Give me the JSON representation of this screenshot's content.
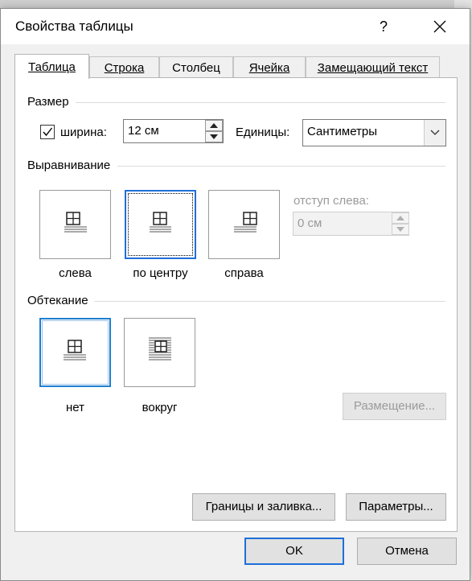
{
  "window": {
    "title": "Свойства таблицы",
    "help": "?",
    "close_icon": "close-icon"
  },
  "tabs": [
    {
      "label": "Таблица",
      "active": true
    },
    {
      "label": "Строка",
      "active": false
    },
    {
      "label": "Столбец",
      "active": false
    },
    {
      "label": "Ячейка",
      "active": false
    },
    {
      "label": "Замещающий текст",
      "active": false
    }
  ],
  "size": {
    "group_label": "Размер",
    "width_checkbox_checked": true,
    "width_label": "ширина:",
    "width_value": "12 см",
    "units_label": "Единицы:",
    "units_value": "Сантиметры"
  },
  "alignment": {
    "group_label": "Выравнивание",
    "options": [
      "слева",
      "по центру",
      "справа"
    ],
    "selected": "по центру",
    "indent_label": "отступ слева:",
    "indent_value": "0 см"
  },
  "wrapping": {
    "group_label": "Обтекание",
    "options": [
      "нет",
      "вокруг"
    ],
    "selected": "нет",
    "positioning_button": "Размещение..."
  },
  "buttons": {
    "borders": "Границы и заливка...",
    "options": "Параметры...",
    "ok": "OK",
    "cancel": "Отмена"
  },
  "colors": {
    "accent": "#1e6fd9",
    "disabled": "#9a9a9a"
  }
}
